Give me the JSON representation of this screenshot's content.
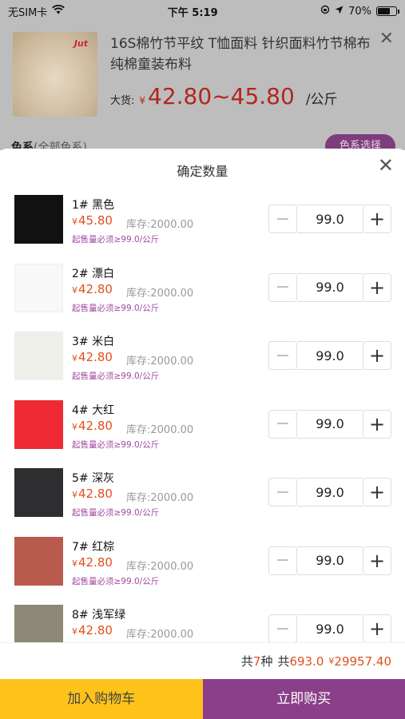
{
  "status_bar": {
    "carrier": "无SIM卡",
    "time": "下午 5:19",
    "battery": "70%",
    "battery_level": 0.7
  },
  "product": {
    "title": "16S棉竹节平纹 T恤面料 针织面料竹节棉布 纯棉童装布料",
    "price_label": "大货:",
    "currency": "¥",
    "price_range": "42.80~45.80",
    "unit": "/公斤",
    "image_logo": "Jut",
    "color_section_label": "色系",
    "color_section_sub": "(全部色系)",
    "color_pick_label": "色系选择"
  },
  "sheet": {
    "title": "确定数量"
  },
  "common": {
    "currency": "¥",
    "min_note": "起售量必须≥99.0/公斤"
  },
  "items": [
    {
      "name": "1# 黑色",
      "price": "45.80",
      "stock": "库存:2000.00",
      "qty": "99.0",
      "color": "#111111"
    },
    {
      "name": "2# 漂白",
      "price": "42.80",
      "stock": "库存:2000.00",
      "qty": "99.0",
      "color": "#f8f8f8"
    },
    {
      "name": "3# 米白",
      "price": "42.80",
      "stock": "库存:2000.00",
      "qty": "99.0",
      "color": "#efefe9"
    },
    {
      "name": "4# 大红",
      "price": "42.80",
      "stock": "库存:2000.00",
      "qty": "99.0",
      "color": "#f02a34"
    },
    {
      "name": "5# 深灰",
      "price": "42.80",
      "stock": "库存:2000.00",
      "qty": "99.0",
      "color": "#2e2e30"
    },
    {
      "name": "7# 红棕",
      "price": "42.80",
      "stock": "库存:2000.00",
      "qty": "99.0",
      "color": "#b95a4e"
    },
    {
      "name": "8# 浅军绿",
      "price": "42.80",
      "stock": "库存:2000.00",
      "qty": "99.0",
      "color": "#8d8877"
    }
  ],
  "summary": {
    "count_prefix": "共",
    "count": "7",
    "count_suffix": "种",
    "total_qty_prefix": "共",
    "total_qty": "693.0",
    "currency": "¥",
    "total_price": "29957.40"
  },
  "actions": {
    "add_to_cart": "加入购物车",
    "buy_now": "立即购买"
  },
  "icons": {
    "wifi": "wifi-icon",
    "location": "location-arrow-icon",
    "lock_rotation": "rotation-lock-icon",
    "close": "close-icon",
    "minus": "minus-icon",
    "plus": "plus-icon"
  }
}
